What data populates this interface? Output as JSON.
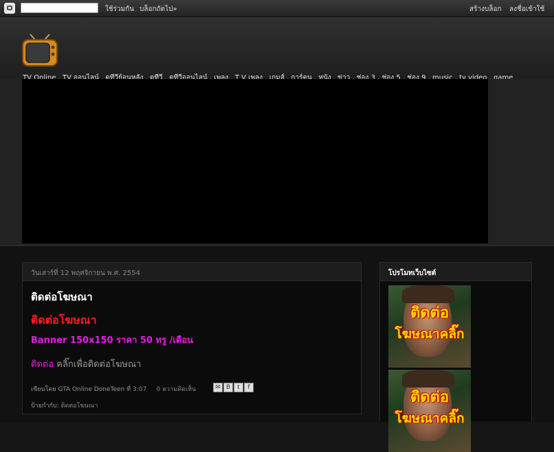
{
  "navbar": {
    "share_label": "ใช้ร่วมกัน",
    "next_blog_label": "บล็อกถัดไป»",
    "create_blog_label": "สร้างบล็อก",
    "sign_in_label": "ลงชื่อเข้าใช้",
    "search_value": ""
  },
  "header": {
    "description": "TV Online , TV ออนไลน์ , ดูทีวีย้อนหลัง , ดูทีวี , ดูทีวีออนไลน์ , เพลง , T V เพลง , เกมส์ , การ์ตูน , หนัง , ข่าว , ช่อง 3 , ช่อง 5 , ช่อง 9 , music , tv video , game",
    "logo_icon": "tv-icon"
  },
  "post": {
    "date": "วันเสาร์ที่ 12 พฤศจิกายน พ.ศ. 2554",
    "title": "ติดต่อโฆษณา",
    "red_heading": "ติดต่อโฆษณา",
    "banner_price": "Banner 150x150 ราคา 50 ทรู /เดือน",
    "contact_link": "ติดต่อ",
    "contact_text": " คลิ๊กเพื่อติดต่อโฆษณา",
    "posted_by_label": "เขียนโดย",
    "author": "GTA Online DoneTeen",
    "at_label": "ที่",
    "time": "3:07",
    "comments": "0 ความคิดเห็น",
    "labels_prefix": "ป้ายกำกับ:",
    "label": "ติดต่อโฆษณา",
    "share_icons": [
      "email-icon",
      "blogthis-icon",
      "twitter-icon",
      "facebook-icon"
    ]
  },
  "sidebar": {
    "widget_title": "โปรโมทเว็บไซต์",
    "promo_line1": "ติดต่อ",
    "promo_line2": "โฆษณาคลิ๊ก"
  },
  "colors": {
    "post_title": "#ffffff",
    "red_heading": "#ff1a1a",
    "magenta": "#e41ee4",
    "background": "#161616"
  }
}
